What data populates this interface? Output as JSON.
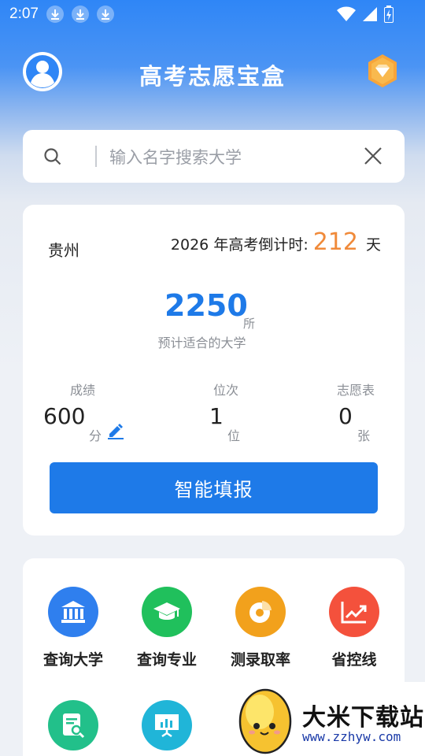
{
  "status": {
    "time": "2:07",
    "download_icons": [
      "download-icon",
      "download-icon",
      "download-icon"
    ],
    "right_icons": [
      "wifi-icon",
      "signal-icon",
      "battery-icon"
    ]
  },
  "header": {
    "title": "高考志愿宝盒",
    "avatar_icon": "user-icon",
    "vip_icon": "vip-diamond-icon"
  },
  "search": {
    "placeholder": "输入名字搜索大学"
  },
  "summary": {
    "province": "贵州",
    "countdown_prefix": "2026 年高考倒计时:",
    "countdown_days": "212",
    "countdown_suffix": "天",
    "fit_count": "2250",
    "fit_unit": "所",
    "fit_caption": "预计适合的大学",
    "stats": [
      {
        "label": "成绩",
        "value": "600",
        "unit": "分"
      },
      {
        "label": "位次",
        "value": "1",
        "unit": "位"
      },
      {
        "label": "志愿表",
        "value": "0",
        "unit": "张"
      }
    ],
    "smart_button": "智能填报"
  },
  "tools": [
    {
      "label": "查询大学",
      "icon": "university-icon",
      "color": "#2f7fee"
    },
    {
      "label": "查询专业",
      "icon": "graduation-cap-icon",
      "color": "#20c05c"
    },
    {
      "label": "测录取率",
      "icon": "pie-chart-icon",
      "color": "#f2a11c"
    },
    {
      "label": "省控线",
      "icon": "trend-chart-icon",
      "color": "#f4513c"
    },
    {
      "label": "",
      "icon": "document-search-icon",
      "color": "#22c08a"
    },
    {
      "label": "",
      "icon": "presentation-chart-icon",
      "color": "#20b5d8"
    }
  ],
  "watermark": {
    "title": "大米下载站",
    "url": "www.zzhyw.com"
  },
  "colors": {
    "primary": "#1e7ae8",
    "countdown": "#f08a3a"
  }
}
